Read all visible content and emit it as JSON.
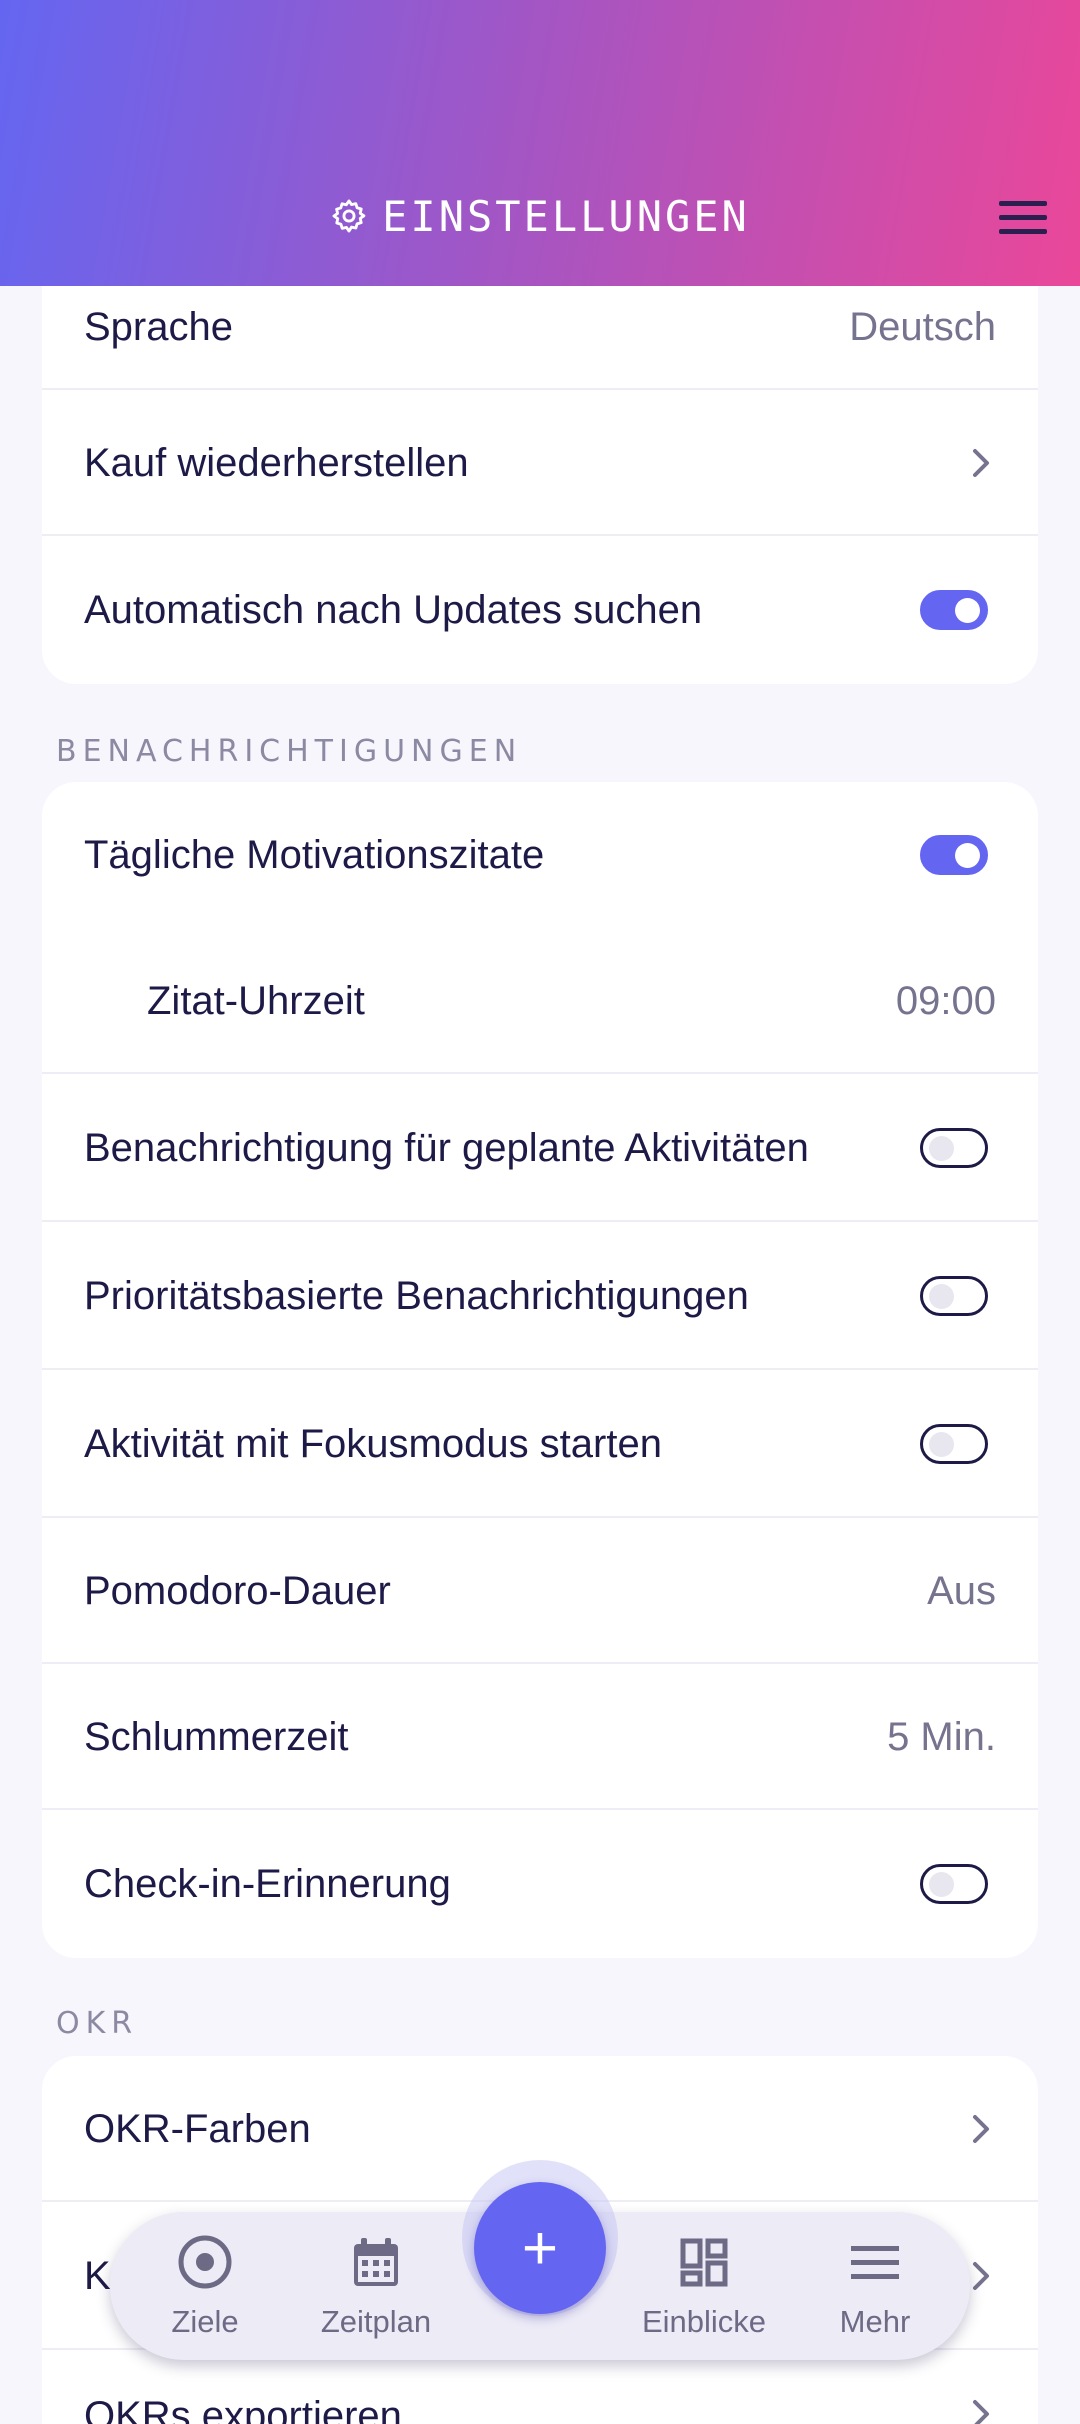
{
  "header": {
    "title": "EINSTELLUNGEN",
    "icon": "gear-icon"
  },
  "general": {
    "language_label": "Sprache",
    "language_value": "Deutsch",
    "restore_label": "Kauf wiederherstellen",
    "updates_label": "Automatisch nach Updates suchen",
    "updates_on": true
  },
  "notifications": {
    "section_label": "BENACHRICHTIGUNGEN",
    "quotes_label": "Tägliche Motivationszitate",
    "quotes_on": true,
    "quote_time_label": "Zitat-Uhrzeit",
    "quote_time_value": "09:00",
    "planned_label": "Benachrichtigung für geplante Aktivitäten",
    "planned_on": false,
    "priority_label": "Prioritätsbasierte Benachrichtigungen",
    "priority_on": false,
    "focus_label": "Aktivität mit Fokusmodus starten",
    "focus_on": false,
    "pomodoro_label": "Pomodoro-Dauer",
    "pomodoro_value": "Aus",
    "snooze_label": "Schlummerzeit",
    "snooze_value": "5 Min.",
    "checkin_label": "Check-in-Erinnerung",
    "checkin_on": false
  },
  "okr": {
    "section_label": "OKR",
    "colors_label": "OKR-Farben",
    "partial_label": "K",
    "export_label": "OKRs exportieren"
  },
  "bottom_nav": {
    "items": [
      {
        "label": "Ziele",
        "icon": "target-icon"
      },
      {
        "label": "Zeitplan",
        "icon": "calendar-icon"
      },
      {
        "label": "Einblicke",
        "icon": "dashboard-icon"
      },
      {
        "label": "Mehr",
        "icon": "menu-icon"
      }
    ],
    "fab_label": "+"
  },
  "colors": {
    "accent": "#6466f1",
    "gradient_start": "#6466f1",
    "gradient_end": "#ea4799",
    "text": "#1d1a47",
    "muted": "#76738f"
  }
}
